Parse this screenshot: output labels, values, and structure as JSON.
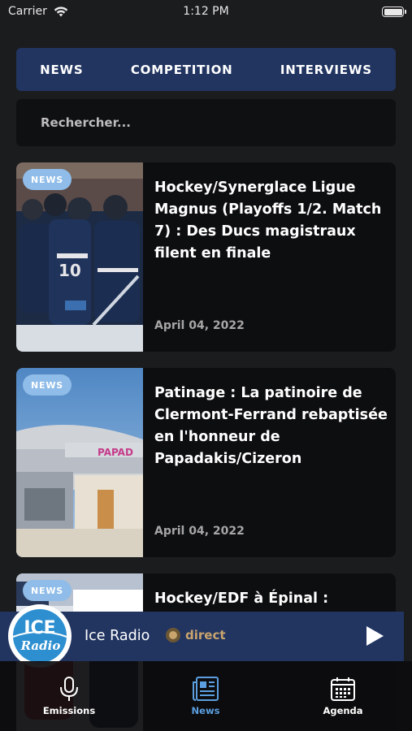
{
  "status_bar": {
    "carrier": "Carrier",
    "time": "1:12 PM"
  },
  "tabs": [
    {
      "label": "NEWS"
    },
    {
      "label": "COMPETITION"
    },
    {
      "label": "INTERVIEWS"
    }
  ],
  "search": {
    "placeholder": "Rechercher..."
  },
  "articles": [
    {
      "badge": "NEWS",
      "title": "Hockey/Synerglace Ligue Magnus (Playoffs 1/2. Match 7) : Des Ducs magistraux filent en finale",
      "date": "April 04, 2022"
    },
    {
      "badge": "NEWS",
      "title": "Patinage : La patinoire de Clermont-Ferrand rebaptisée en l'honneur de Papadakis/Cizeron",
      "date": "April 04, 2022"
    },
    {
      "badge": "NEWS",
      "title": "Hockey/EDF à Épinal :",
      "date": ""
    }
  ],
  "player": {
    "logo_text_top": "ICE",
    "logo_text_bottom": "Radio",
    "title": "Ice Radio",
    "live_label": "direct"
  },
  "bottom_nav": [
    {
      "label": "Emissions",
      "icon": "microphone-icon",
      "active": false
    },
    {
      "label": "News",
      "icon": "newspaper-icon",
      "active": true
    },
    {
      "label": "Agenda",
      "icon": "calendar-icon",
      "active": false
    }
  ],
  "colors": {
    "background": "#1b1c1e",
    "tab_bar": "#223561",
    "badge": "#8fbce8",
    "active_nav": "#5b9fe0",
    "live": "#c9a46d"
  }
}
